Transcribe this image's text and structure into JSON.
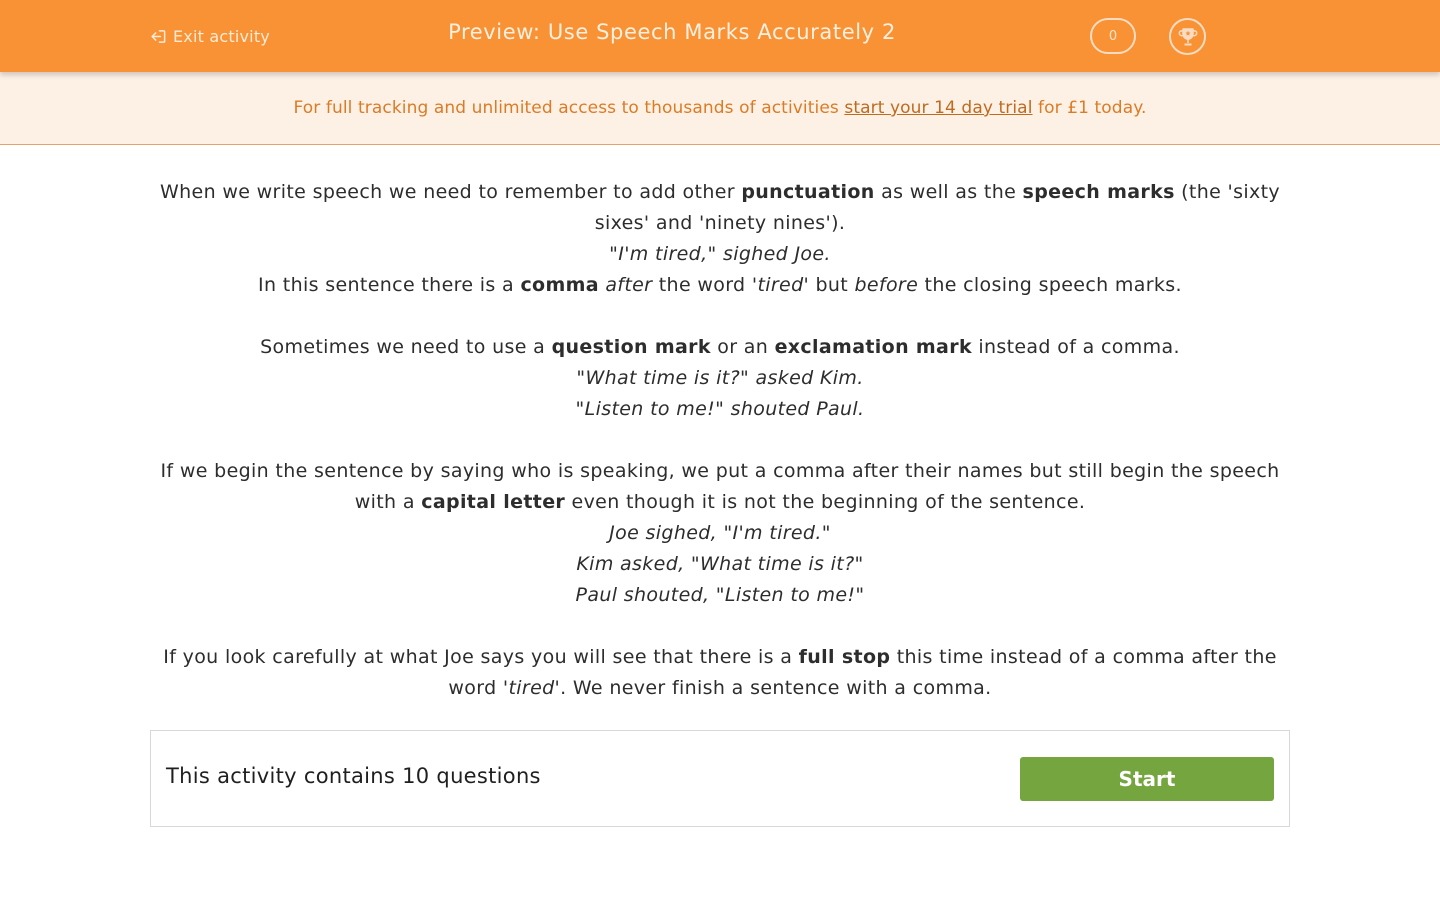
{
  "header": {
    "exit_label": "Exit activity",
    "exit_icon": "exit-arrow-icon",
    "title": "Preview: Use Speech Marks Accurately 2",
    "score": "0",
    "trophy_icon": "trophy-icon",
    "brand_color": "#f99234"
  },
  "banner": {
    "text_before": "For full tracking and unlimited access to thousands of activities ",
    "link_text": "start your 14 day trial",
    "text_after": " for £1 today."
  },
  "lesson": {
    "p1": {
      "a": "When we write speech we need to remember to add other ",
      "b1": "punctuation",
      "c": " as well as the ",
      "b2": "speech marks",
      "d": " (the 'sixty sixes' and 'ninety nines')."
    },
    "ex1": "\"I'm tired,\" sighed Joe.",
    "p2": {
      "a": "In this sentence there is a ",
      "b": "comma",
      "c": " ",
      "i1": "after",
      "d": " the word '",
      "i2": "tired",
      "e": "' but ",
      "i3": "before",
      "f": " the closing speech marks."
    },
    "p3": {
      "a": "Sometimes we need to use a ",
      "b1": "question mark",
      "c": " or an ",
      "b2": "exclamation mark",
      "d": " instead of a comma."
    },
    "ex2": "\"What time is it?\" asked Kim.",
    "ex3": "\"Listen to me!\" shouted Paul.",
    "p4": {
      "a": "If we begin the sentence by saying who is speaking, we put a comma after their names but still begin the speech with a ",
      "b": "capital letter",
      "c": " even though it is not the beginning of the sentence."
    },
    "ex4": "Joe sighed, \"I'm tired.\"",
    "ex5": "Kim asked, \"What time is it?\"",
    "ex6": "Paul shouted, \"Listen to me!\"",
    "p5": {
      "a": "If you look carefully at what Joe says you will see that there is a ",
      "b": "full stop",
      "c": " this time instead of a comma after the word '",
      "i": "tired",
      "d": "'. We never finish a sentence with a comma."
    }
  },
  "activity": {
    "summary": "This activity contains 10 questions",
    "start_label": "Start",
    "start_color": "#75a53f"
  }
}
